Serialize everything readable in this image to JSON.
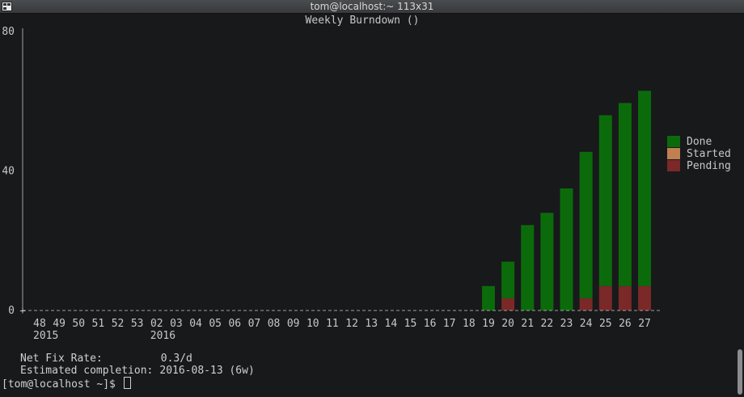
{
  "window": {
    "title": "tom@localhost:~ 113x31"
  },
  "chart_data": {
    "type": "bar",
    "title": "Weekly Burndown ()",
    "x": [
      "48",
      "49",
      "50",
      "51",
      "52",
      "53",
      "02",
      "03",
      "04",
      "05",
      "06",
      "07",
      "08",
      "09",
      "10",
      "11",
      "12",
      "13",
      "14",
      "15",
      "16",
      "17",
      "18",
      "19",
      "20",
      "21",
      "22",
      "23",
      "24",
      "25",
      "26",
      "27"
    ],
    "year_labels": [
      {
        "week": "48",
        "label": "2015"
      },
      {
        "week": "02",
        "label": "2016"
      }
    ],
    "yticks": [
      0,
      40,
      80
    ],
    "ylim": [
      0,
      80
    ],
    "stacked": true,
    "series": [
      {
        "name": "Pending",
        "color": "#7a2828",
        "values": [
          0,
          0,
          0,
          0,
          0,
          0,
          0,
          0,
          0,
          0,
          0,
          0,
          0,
          0,
          0,
          0,
          0,
          0,
          0,
          0,
          0,
          0,
          0,
          0,
          3.5,
          0,
          0,
          0,
          3.5,
          7,
          7,
          7
        ]
      },
      {
        "name": "Started",
        "color": "#c0804f",
        "values": [
          0,
          0,
          0,
          0,
          0,
          0,
          0,
          0,
          0,
          0,
          0,
          0,
          0,
          0,
          0,
          0,
          0,
          0,
          0,
          0,
          0,
          0,
          0,
          0,
          0,
          0,
          0,
          0,
          0,
          0,
          0,
          0
        ]
      },
      {
        "name": "Done",
        "color": "#0b6b0b",
        "values": [
          0,
          0,
          0,
          0,
          0,
          0,
          0,
          0,
          0,
          0,
          0,
          0,
          0,
          0,
          0,
          0,
          0,
          0,
          0,
          0,
          0,
          0,
          0,
          7,
          10.5,
          24.5,
          28,
          35,
          42,
          49,
          52.5,
          56
        ]
      }
    ],
    "legend": [
      "Done",
      "Started",
      "Pending"
    ],
    "legend_position": "right"
  },
  "stats": {
    "net_fix_rate_label": "Net Fix Rate:",
    "net_fix_rate_value": "0.3/d",
    "completion_label": "Estimated completion:",
    "completion_value": "2016-08-13 (6w)"
  },
  "prompt": {
    "text": "[tom@localhost ~]$ "
  }
}
